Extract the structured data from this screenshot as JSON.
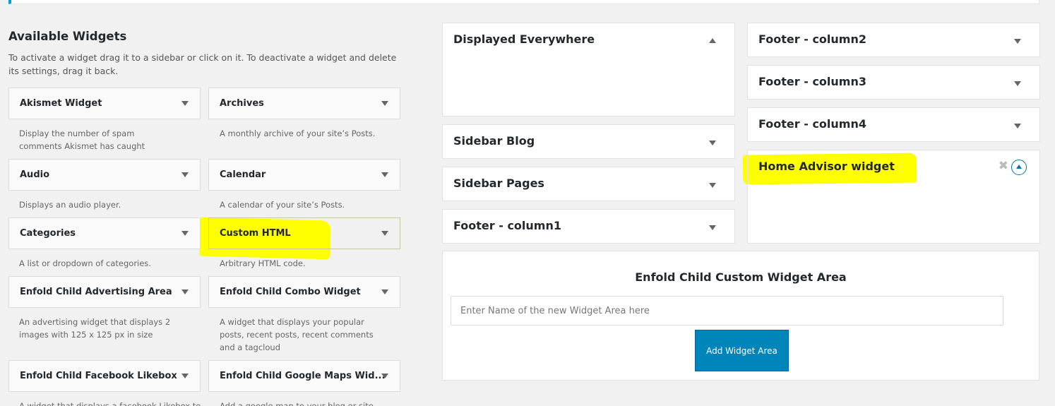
{
  "available": {
    "title": "Available Widgets",
    "description": "To activate a widget drag it to a sidebar or click on it. To deactivate a widget and delete its settings, drag it back."
  },
  "widgets": [
    {
      "label": "Akismet Widget",
      "desc": "Display the number of spam comments Akismet has caught"
    },
    {
      "label": "Archives",
      "desc": "A monthly archive of your site’s Posts."
    },
    {
      "label": "Audio",
      "desc": "Displays an audio player."
    },
    {
      "label": "Calendar",
      "desc": "A calendar of your site’s Posts."
    },
    {
      "label": "Categories",
      "desc": "A list or dropdown of categories."
    },
    {
      "label": "Custom HTML",
      "desc": "Arbitrary HTML code."
    },
    {
      "label": "Enfold Child Advertising Area",
      "desc": "An advertising widget that displays 2 images with 125 x 125 px in size"
    },
    {
      "label": "Enfold Child Combo Widget",
      "desc": "A widget that displays your popular posts, recent posts, recent comments and a tagcloud"
    },
    {
      "label": "Enfold Child Facebook Likebox",
      "desc": "A widget that displays a facebook Likebox to"
    },
    {
      "label": "Enfold Child Google Maps Wid...",
      "desc": "Add a google map to your blog or site"
    }
  ],
  "areas": {
    "displayed_everywhere": "Displayed Everywhere",
    "sidebar_blog": "Sidebar Blog",
    "sidebar_pages": "Sidebar Pages",
    "footer_column1": "Footer - column1",
    "footer_column2": "Footer - column2",
    "footer_column3": "Footer - column3",
    "footer_column4": "Footer - column4",
    "home_advisor": "Home Advisor widget"
  },
  "custom_area": {
    "title": "Enfold Child Custom Widget Area",
    "input_placeholder": "Enter Name of the new Widget Area here",
    "button_label": "Add Widget Area"
  },
  "icons": {
    "collapse": "triangle-down-icon",
    "expand": "triangle-up-icon",
    "remove": "close-icon",
    "toggle": "circle-up-icon"
  },
  "colors": {
    "highlight": "#ffff00",
    "primary_button": "#0085ba",
    "notice_accent": "#00a0d2"
  }
}
